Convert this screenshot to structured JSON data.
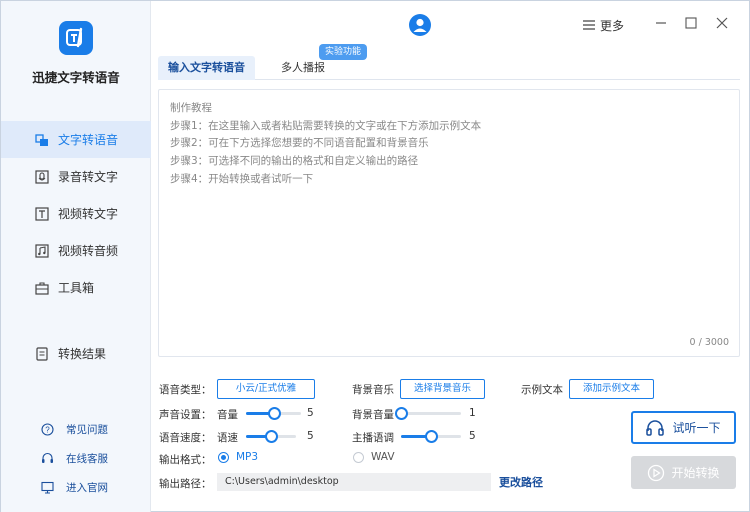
{
  "app": {
    "title": "迅捷文字转语音"
  },
  "sidebar": {
    "items": [
      {
        "label": "文字转语音",
        "icon": "text-to-speech-icon",
        "active": true
      },
      {
        "label": "录音转文字",
        "icon": "recording-icon",
        "active": false
      },
      {
        "label": "视频转文字",
        "icon": "video-to-text-icon",
        "active": false
      },
      {
        "label": "视频转音频",
        "icon": "video-to-audio-icon",
        "active": false
      },
      {
        "label": "工具箱",
        "icon": "toolbox-icon",
        "active": false
      }
    ],
    "result": {
      "label": "转换结果",
      "icon": "result-icon"
    },
    "footer": [
      {
        "label": "常见问题",
        "icon": "question-icon"
      },
      {
        "label": "在线客服",
        "icon": "headset-icon"
      },
      {
        "label": "进入官网",
        "icon": "monitor-icon"
      }
    ]
  },
  "titlebar": {
    "more_label": "更多"
  },
  "tabs": [
    {
      "label": "输入文字转语音",
      "active": true
    },
    {
      "label": "多人播报",
      "active": false
    }
  ],
  "badge": {
    "experimental": "实验功能"
  },
  "editor": {
    "lines": [
      "制作教程",
      "步骤1：在这里输入或者粘贴需要转换的文字或在下方添加示例文本",
      "步骤2：可在下方选择您想要的不同语音配置和背景音乐",
      "步骤3：可选择不同的输出的格式和自定义输出的路径",
      "步骤4：开始转换或者试听一下"
    ],
    "counter": "0 / 3000"
  },
  "settings": {
    "voice_type_label": "语音类型：",
    "voice_type_button": "小云/正式优雅",
    "bgm_label": "背景音乐",
    "bgm_button": "选择背景音乐",
    "sample_label": "示例文本",
    "sample_button": "添加示例文本",
    "sound_label": "声音设置：",
    "volume_label": "音量",
    "volume_value": "5",
    "volume_fraction": 0.5,
    "bg_volume_label": "背景音量",
    "bg_volume_value": "1",
    "bg_volume_fraction": 0.0,
    "speed_section_label": "语音速度：",
    "speed_label": "语速",
    "speed_value": "5",
    "speed_fraction": 0.5,
    "pitch_label": "主播语调",
    "pitch_value": "5",
    "pitch_fraction": 0.5,
    "format_label": "输出格式：",
    "format_mp3": "MP3",
    "format_wav": "WAV",
    "selected_format": "MP3",
    "path_label": "输出路径：",
    "path_value": "C:\\Users\\admin\\desktop",
    "change_path": "更改路径"
  },
  "actions": {
    "try_label": "试听一下",
    "start_label": "开始转换"
  },
  "colors": {
    "accent": "#1a7de8",
    "nav_active_bg": "#dfeafa",
    "disabled": "#d7d9dc"
  }
}
